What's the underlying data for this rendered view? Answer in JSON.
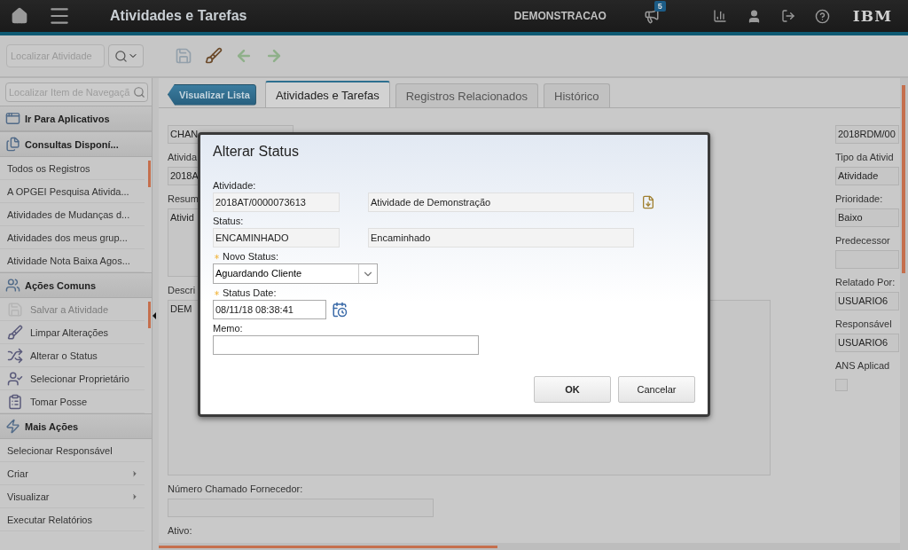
{
  "header": {
    "title": "Atividades e Tarefas",
    "environment": "DEMONSTRACAO",
    "notification_count": "5",
    "logo": "IBM"
  },
  "toolbar": {
    "search": {
      "placeholder": "Localizar Atividade"
    }
  },
  "sidebar": {
    "search": {
      "placeholder": "Localizar Item de Navegaçã"
    },
    "sections": [
      {
        "title": "Ir Para Aplicativos"
      },
      {
        "title": "Consultas Disponí...",
        "items": [
          {
            "label": "Todos os Registros"
          },
          {
            "label": "A OPGEI Pesquisa Ativida..."
          },
          {
            "label": "Atividades de Mudanças d..."
          },
          {
            "label": "Atividades dos meus grup..."
          },
          {
            "label": "Atividade Nota Baixa Agos..."
          }
        ]
      },
      {
        "title": "Ações Comuns",
        "items": [
          {
            "label": "Salvar a Atividade",
            "disabled": true
          },
          {
            "label": "Limpar Alterações",
            "disabled": false
          },
          {
            "label": "Alterar o Status",
            "disabled": false
          },
          {
            "label": "Selecionar Proprietário",
            "disabled": false
          },
          {
            "label": "Tomar Posse",
            "disabled": false
          }
        ]
      },
      {
        "title": "Mais Ações",
        "items": [
          {
            "label": "Selecionar Responsável",
            "submenu": false
          },
          {
            "label": "Criar",
            "submenu": true
          },
          {
            "label": "Visualizar",
            "submenu": true
          },
          {
            "label": "Executar Relatórios",
            "submenu": false
          }
        ]
      }
    ]
  },
  "back_button": "Visualizar Lista",
  "tabs": [
    {
      "label": "Atividades e Tarefas",
      "selected": true
    },
    {
      "label": "Registros Relacionados",
      "selected": false
    },
    {
      "label": "Histórico",
      "selected": false
    }
  ],
  "form_left": [
    {
      "kind": "field",
      "value": "CHAN"
    },
    {
      "kind": "label",
      "text": "Ativida"
    },
    {
      "kind": "field",
      "value": "2018A"
    },
    {
      "kind": "label",
      "text": "Resum"
    },
    {
      "kind": "memo",
      "value": "Ativid"
    },
    {
      "kind": "label",
      "text": "Descri"
    },
    {
      "kind": "large_memo",
      "value": "DEM"
    },
    {
      "kind": "label",
      "text": "Número Chamado Fornecedor:"
    },
    {
      "kind": "wide_field"
    },
    {
      "kind": "label",
      "text": "Ativo:"
    }
  ],
  "form_right": [
    {
      "kind": "field",
      "value": "2018RDM/00"
    },
    {
      "kind": "label",
      "text": "Tipo da Ativid"
    },
    {
      "kind": "field",
      "value": "Atividade"
    },
    {
      "kind": "label",
      "text": "Prioridade:"
    },
    {
      "kind": "field",
      "value": "Baixo"
    },
    {
      "kind": "label",
      "text": "Predecessor"
    },
    {
      "kind": "field"
    },
    {
      "kind": "label",
      "text": "Relatado Por:"
    },
    {
      "kind": "field",
      "value": "USUARIO6"
    },
    {
      "kind": "label",
      "text": "Responsável"
    },
    {
      "kind": "field",
      "value": "USUARIO6"
    },
    {
      "kind": "label",
      "text": "ANS Aplicad"
    },
    {
      "kind": "checkbox",
      "checked": false
    }
  ],
  "dialog": {
    "title": "Alterar Status",
    "fields": [
      {
        "kind": "lookup",
        "label": "Atividade:",
        "required": false,
        "value": "2018AT/0000073613",
        "description": "Atividade de Demonstração"
      },
      {
        "kind": "readonly",
        "label": "Status:",
        "required": false,
        "value": "ENCAMINHADO",
        "description": "Encaminhado"
      },
      {
        "kind": "select",
        "label": "Novo Status:",
        "required": true,
        "value": "Aguardando Cliente"
      },
      {
        "kind": "date",
        "label": "Status Date:",
        "required": true,
        "value": "08/11/18 08:38:41"
      },
      {
        "kind": "text",
        "label": "Memo:",
        "required": false
      }
    ],
    "buttons": [
      {
        "label": "OK",
        "primary": true
      },
      {
        "label": "Cancelar",
        "primary": false
      }
    ]
  }
}
